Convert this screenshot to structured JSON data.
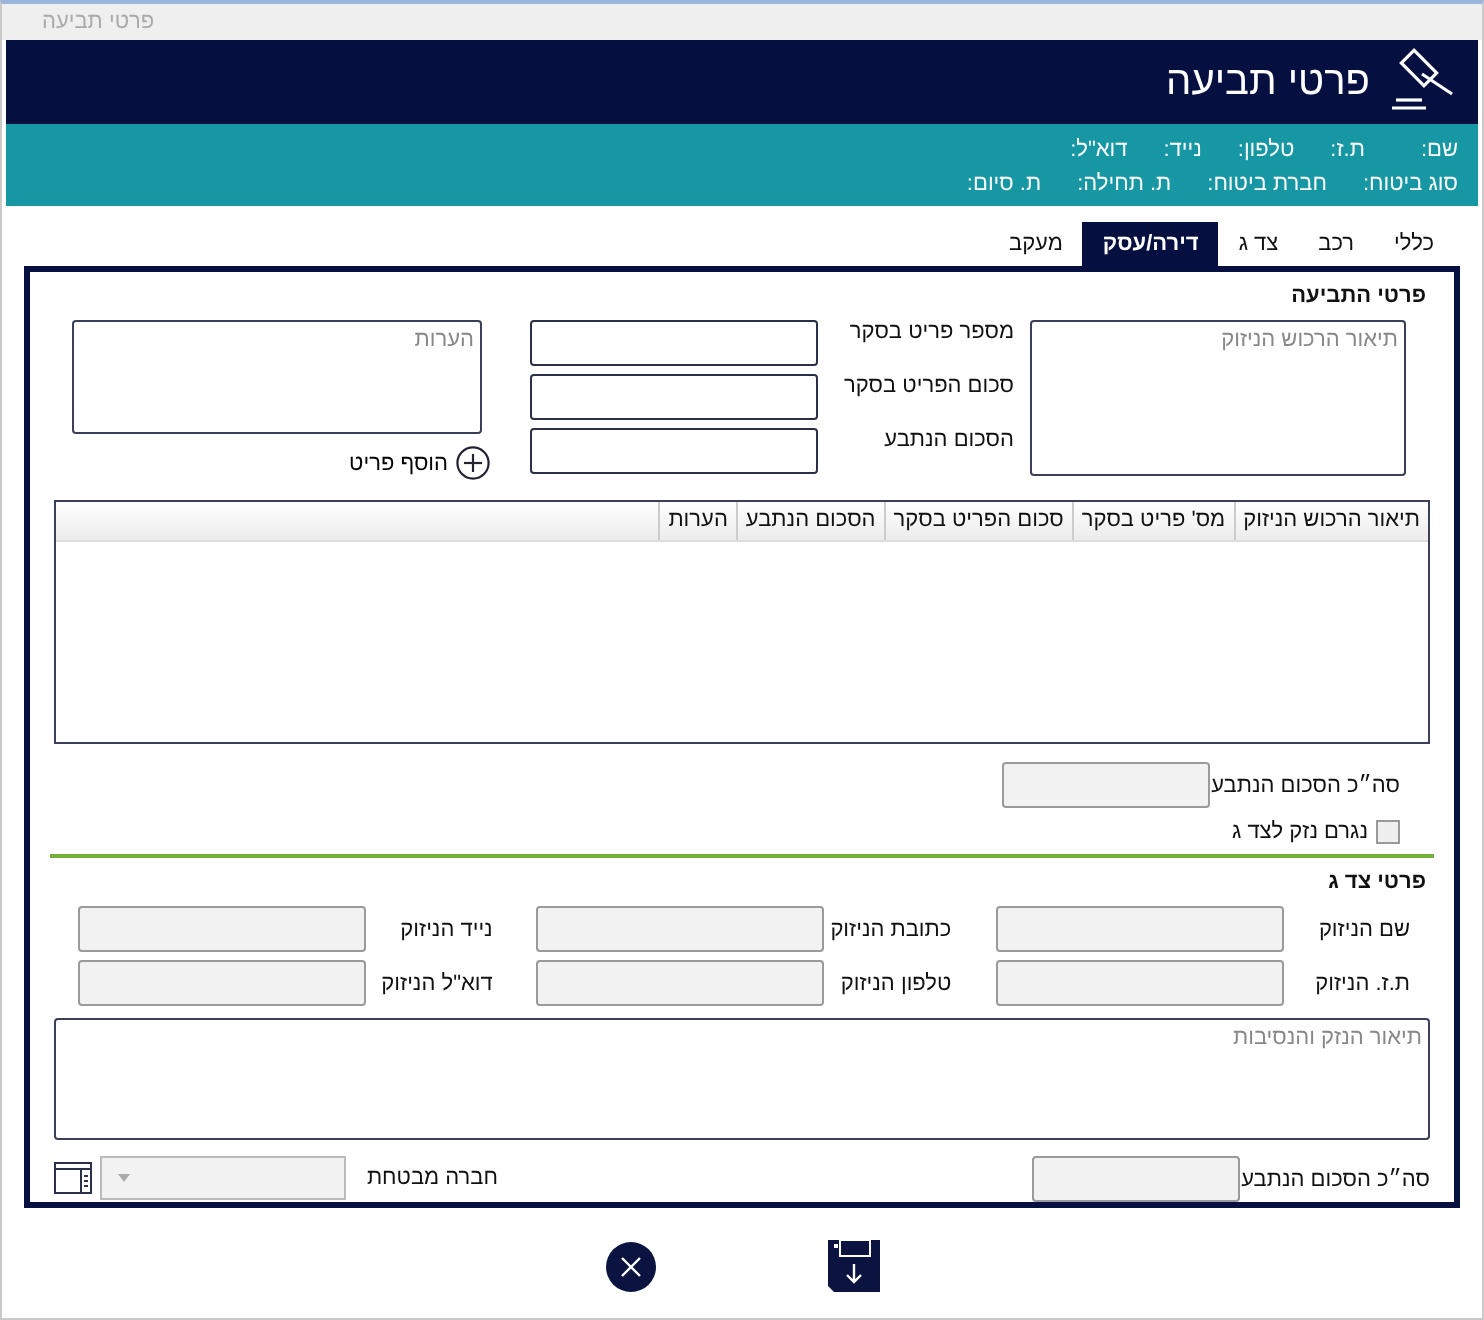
{
  "window": {
    "title": "פרטי תביעה"
  },
  "header": {
    "title": "פרטי תביעה"
  },
  "info_bar": {
    "contact_labels": [
      "שם:",
      "ת.ז:",
      "טלפון:",
      "נייד:",
      "דוא\"ל:"
    ],
    "policy_labels": [
      "סוג ביטוח:",
      "חברת ביטוח:",
      "ת. תחילה:",
      "ת. סיום:"
    ]
  },
  "tabs": [
    {
      "label": "כללי",
      "selected": false
    },
    {
      "label": "רכב",
      "selected": false
    },
    {
      "label": "צד ג",
      "selected": false
    },
    {
      "label": "דירה/עסק",
      "selected": true
    },
    {
      "label": "מעקב",
      "selected": false
    }
  ],
  "claim_details": {
    "title": "פרטי התביעה",
    "description": {
      "placeholder": "תיאור הרכוש הניזוק"
    },
    "fields": [
      {
        "label": "מספר פריט בסקר",
        "disabled": false
      },
      {
        "label": "סכום הפריט בסקר",
        "disabled": false
      },
      {
        "label": "הסכום הנתבע",
        "disabled": false
      }
    ],
    "notes": {
      "placeholder": "הערות"
    },
    "add_button": "הוסף פריט",
    "table": {
      "columns": [
        "תיאור הרכוש הניזוק",
        "מס' פריט בסקר",
        "סכום הפריט בסקר",
        "הסכום הנתבע",
        "הערות"
      ]
    },
    "total": {
      "label": "סה״כ הסכום הנתבע",
      "disabled": true
    },
    "third_party_damage": {
      "label": "נגרם נזק לצד ג",
      "checked": false
    }
  },
  "third_party": {
    "title": "פרטי צד ג",
    "fields": [
      {
        "label": "שם הניזוק",
        "disabled": true
      },
      {
        "label": "כתובת הניזוק",
        "disabled": true
      },
      {
        "label": "נייד הניזוק",
        "disabled": true
      },
      {
        "label": "ת.ז. הניזוק",
        "disabled": true
      },
      {
        "label": "טלפון הניזוק",
        "disabled": true
      },
      {
        "label": "דוא\"ל הניזוק",
        "disabled": true
      }
    ],
    "description": {
      "placeholder": "תיאור הנזק והנסיבות"
    },
    "total": {
      "label": "סה״כ הסכום הנתבע",
      "disabled": true
    },
    "insurer": {
      "label": "חברה מבטחת",
      "disabled": true
    }
  }
}
